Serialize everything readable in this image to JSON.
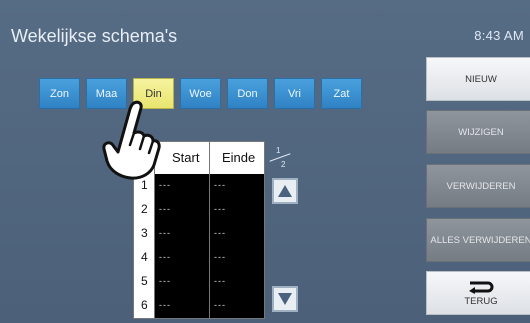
{
  "header": {
    "title": "Wekelijkse schema's",
    "time": "8:43 AM"
  },
  "days": [
    {
      "label": "Zon",
      "selected": false
    },
    {
      "label": "Maa",
      "selected": false
    },
    {
      "label": "Din",
      "selected": true
    },
    {
      "label": "Woe",
      "selected": false
    },
    {
      "label": "Don",
      "selected": false
    },
    {
      "label": "Vri",
      "selected": false
    },
    {
      "label": "Zat",
      "selected": false
    }
  ],
  "table": {
    "headers": {
      "start": "Start",
      "end": "Einde"
    },
    "rows": [
      {
        "n": "1",
        "start": "---",
        "end": "---"
      },
      {
        "n": "2",
        "start": "---",
        "end": "---"
      },
      {
        "n": "3",
        "start": "---",
        "end": "---"
      },
      {
        "n": "4",
        "start": "---",
        "end": "---"
      },
      {
        "n": "5",
        "start": "---",
        "end": "---"
      },
      {
        "n": "6",
        "start": "---",
        "end": "---"
      }
    ]
  },
  "pagination": {
    "current": "1",
    "total": "2"
  },
  "buttons": {
    "new": "NIEUW",
    "edit": "WIJZIGEN",
    "delete": "VERWIJDEREN",
    "delete_all": "ALLES VERWIJDEREN",
    "back": "TERUG"
  },
  "colors": {
    "selected_day": "#eee87a",
    "day_button": "#3b8fd0",
    "background": "#526680"
  },
  "icons": {
    "pointer": "hand-pointer-icon",
    "up": "arrow-up-icon",
    "down": "arrow-down-icon",
    "back": "return-arrow-icon"
  }
}
